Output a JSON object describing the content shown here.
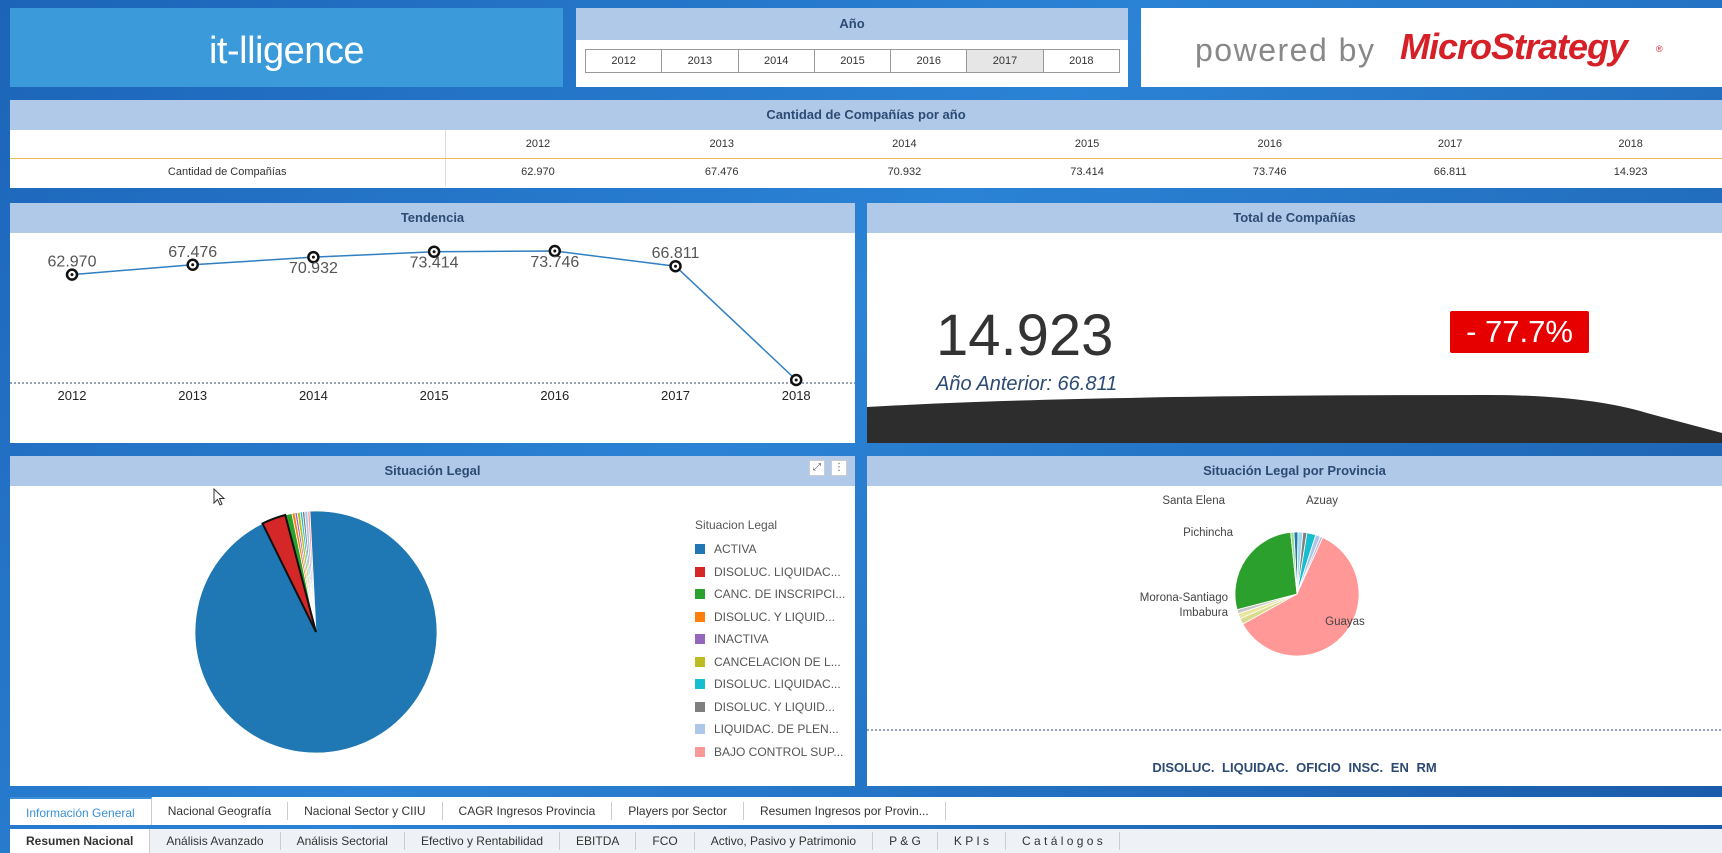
{
  "logo": {
    "text": "it-lligence"
  },
  "year_selector": {
    "title": "Año",
    "years": [
      "2012",
      "2013",
      "2014",
      "2015",
      "2016",
      "2017",
      "2018"
    ],
    "selected": "2017"
  },
  "powered": {
    "prefix": "powered by",
    "brand": "MicroStrategy",
    "reg": "®"
  },
  "table": {
    "title": "Cantidad de Compañías por año",
    "columns": [
      "2012",
      "2013",
      "2014",
      "2015",
      "2016",
      "2017",
      "2018"
    ],
    "row_label": "Cantidad de Compañías",
    "values": [
      "62.970",
      "67.476",
      "70.932",
      "73.414",
      "73.746",
      "66.811",
      "14.923"
    ]
  },
  "trend": {
    "title": "Tendencia",
    "line_color": "#2f7fc1"
  },
  "total": {
    "title": "Total de Compañías",
    "value": "14.923",
    "previous": "Año Anterior: 66.811",
    "change": "- 77.7%",
    "change_color": "#e60000"
  },
  "legal": {
    "title": "Situación Legal",
    "legend_title": "Situacion Legal",
    "legend": [
      {
        "label": "ACTIVA",
        "color": "#1f77b4"
      },
      {
        "label": "DISOLUC. LIQUIDAC...",
        "color": "#d62728"
      },
      {
        "label": "CANC. DE INSCRIPCI...",
        "color": "#2ca02c"
      },
      {
        "label": "DISOLUC. Y LIQUID...",
        "color": "#ff7f0e"
      },
      {
        "label": "INACTIVA",
        "color": "#9467bd"
      },
      {
        "label": "CANCELACION DE L...",
        "color": "#bcbd22"
      },
      {
        "label": "DISOLUC. LIQUIDAC...",
        "color": "#17becf"
      },
      {
        "label": "DISOLUC. Y LIQUID...",
        "color": "#7f7f7f"
      },
      {
        "label": "LIQUIDAC. DE PLEN...",
        "color": "#aec7e8"
      },
      {
        "label": "BAJO CONTROL SUP...",
        "color": "#ff9896"
      }
    ],
    "tools": {
      "expand": "⤢",
      "menu": "⋮"
    }
  },
  "province": {
    "title": "Situación Legal por Provincia",
    "labels": [
      "Santa Elena",
      "Azuay",
      "Pichincha",
      "Morona-Santiago",
      "Imbabura",
      "Guayas"
    ],
    "footer": "DISOLUC. LIQUIDAC. OFICIO INSC. EN RM"
  },
  "tabs_top": [
    "Información General",
    "Nacional Geografía",
    "Nacional Sector y CIIU",
    "CAGR Ingresos Provincia",
    "Players por Sector",
    "Resumen Ingresos por Provin..."
  ],
  "tabs_bottom": [
    "Resumen Nacional",
    "Análisis Avanzado",
    "Análisis Sectorial",
    "Efectivo y Rentabilidad",
    "EBITDA",
    "FCO",
    "Activo, Pasivo y Patrimonio",
    "P & G",
    "K P I s",
    "C a t á l o g o s"
  ],
  "chart_data": [
    {
      "type": "line",
      "title": "Tendencia",
      "x": [
        "2012",
        "2013",
        "2014",
        "2015",
        "2016",
        "2017",
        "2018"
      ],
      "series": [
        {
          "values": [
            62970,
            67476,
            70932,
            73414,
            73746,
            66811,
            14923
          ]
        }
      ],
      "data_labels": [
        "62.970",
        "67.476",
        "70.932",
        "73.414",
        "73.746",
        "66.811"
      ]
    },
    {
      "type": "pie",
      "title": "Situación Legal",
      "categories": [
        "ACTIVA",
        "DISOLUC. LIQUIDAC...",
        "CANC. DE INSCRIPCI...",
        "DISOLUC. Y LIQUID...",
        "INACTIVA",
        "CANCELACION DE L...",
        "DISOLUC. LIQUIDAC...",
        "DISOLUC. Y LIQUID...",
        "LIQUIDAC. DE PLEN...",
        "BAJO CONTROL SUP..."
      ],
      "values": [
        93.5,
        3.2,
        0.9,
        0.4,
        0.3,
        0.4,
        0.3,
        0.3,
        0.4,
        0.3
      ]
    },
    {
      "type": "pie",
      "title": "Situación Legal por Provincia",
      "categories": [
        "Santa Elena",
        "Azuay",
        "Pichincha",
        "Morona-Santiago",
        "Imbabura",
        "Guayas"
      ],
      "values": [
        2,
        5,
        30,
        2,
        3,
        58
      ]
    }
  ]
}
